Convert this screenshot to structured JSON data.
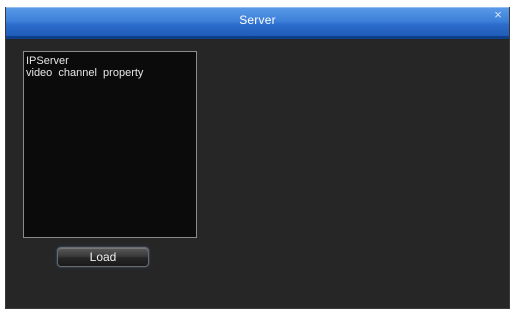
{
  "window": {
    "title": "Server",
    "close_glyph": "×"
  },
  "list": {
    "items": [
      "IPServer",
      "video  channel  property"
    ]
  },
  "buttons": {
    "load_label": "Load"
  },
  "colors": {
    "title_bar": "#2c6ccb",
    "dialog_bg": "#262626",
    "list_bg": "#0b0b0b"
  }
}
